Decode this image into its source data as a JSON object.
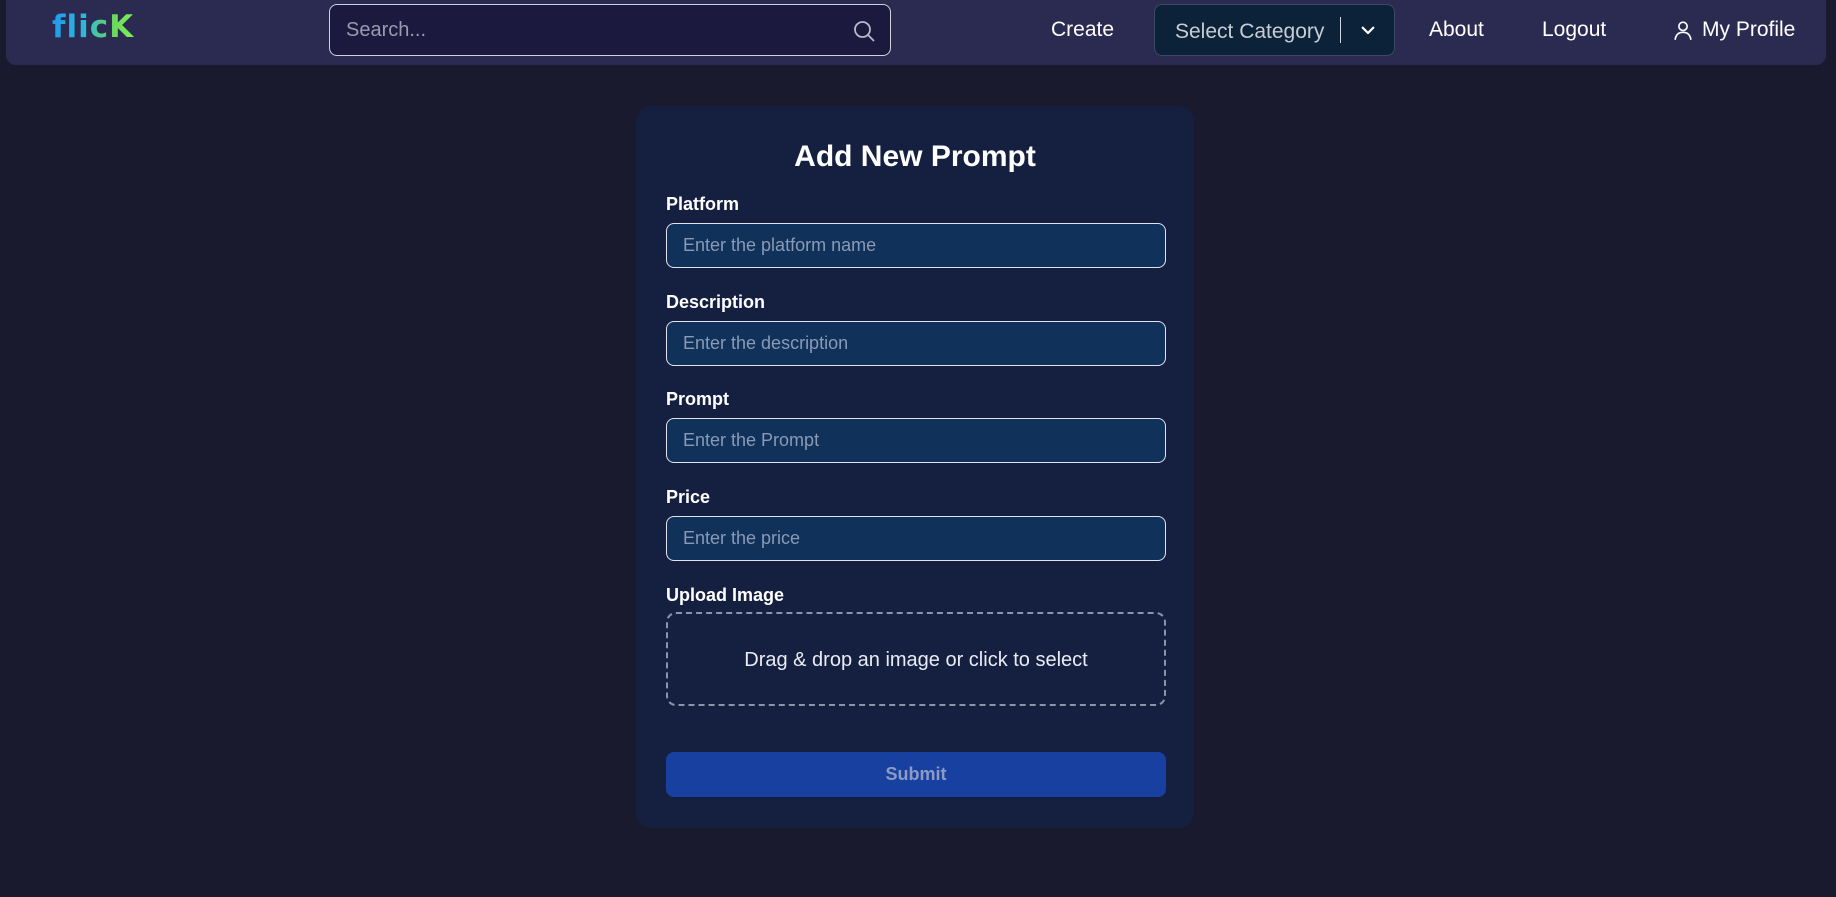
{
  "header": {
    "logo": "flicK",
    "search": {
      "placeholder": "Search...",
      "value": ""
    },
    "nav": {
      "create": "Create",
      "category": "Select Category",
      "about": "About",
      "logout": "Logout",
      "profile": "My Profile"
    }
  },
  "form": {
    "title": "Add New Prompt",
    "fields": [
      {
        "label": "Platform",
        "placeholder": "Enter the platform name",
        "value": ""
      },
      {
        "label": "Description",
        "placeholder": "Enter the description",
        "value": ""
      },
      {
        "label": "Prompt",
        "placeholder": "Enter the Prompt",
        "value": ""
      },
      {
        "label": "Price",
        "placeholder": "Enter the price",
        "value": ""
      }
    ],
    "upload": {
      "label": "Upload Image",
      "hint": "Drag & drop an image or click to select"
    },
    "submit_label": "Submit"
  },
  "icons": {
    "search": "search-icon",
    "chevron": "chevron-down-icon",
    "user": "user-icon"
  },
  "colors": {
    "page_background": "#1a1a2e",
    "navbar": "#2b2b52",
    "card": "#152040",
    "input_background": "#10315a",
    "submit": "#1740a0",
    "logo_gradient_start": "#1e9bf0",
    "logo_gradient_end": "#7cf05a"
  }
}
